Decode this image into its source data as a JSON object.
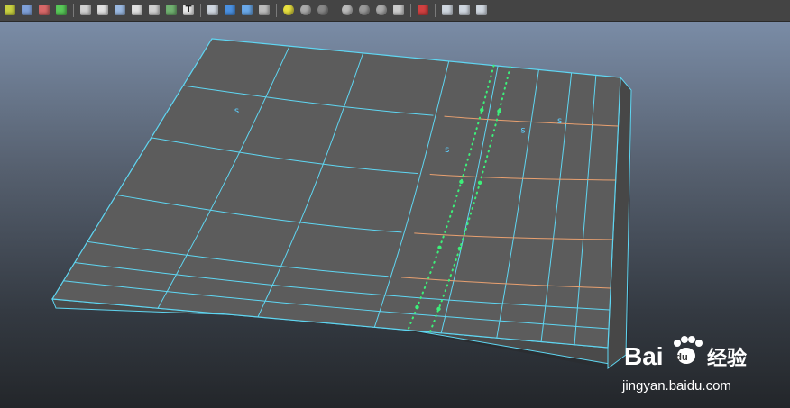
{
  "toolbar": {
    "buttons": [
      {
        "name": "panel-layout-button",
        "icon": "columns-icon"
      },
      {
        "name": "select-camera-button",
        "icon": "camera-icon"
      },
      {
        "name": "bookmark-button",
        "icon": "bookmark-icon"
      },
      {
        "name": "image-plane-button",
        "icon": "image-plane-icon"
      },
      {
        "name": "grid-toggle-button",
        "icon": "grid-icon"
      },
      {
        "name": "film-gate-button",
        "icon": "film-gate-icon"
      },
      {
        "name": "resolution-gate-button",
        "icon": "resolution-gate-icon"
      },
      {
        "name": "gate-mask-button",
        "icon": "gate-mask-icon"
      },
      {
        "name": "field-chart-button",
        "icon": "field-chart-icon"
      },
      {
        "name": "safe-action-button",
        "icon": "safe-action-icon"
      },
      {
        "name": "safe-title-button",
        "icon": "safe-title-icon"
      },
      {
        "name": "wireframe-button",
        "icon": "wireframe-cube-icon"
      },
      {
        "name": "smooth-shade-button",
        "icon": "shaded-cube-icon"
      },
      {
        "name": "wireframe-on-shaded-button",
        "icon": "wire-shaded-cube-icon"
      },
      {
        "name": "textured-button",
        "icon": "checker-icon"
      },
      {
        "name": "use-all-lights-button",
        "icon": "light-bulb-icon"
      },
      {
        "name": "shadows-button",
        "icon": "shadow-sphere-icon"
      },
      {
        "name": "screen-space-ao-button",
        "icon": "ao-sphere-icon"
      },
      {
        "name": "motion-blur-button",
        "icon": "motion-blur-icon"
      },
      {
        "name": "multisample-aa-button",
        "icon": "aa-icon"
      },
      {
        "name": "depth-of-field-button",
        "icon": "dof-icon"
      },
      {
        "name": "xray-button",
        "icon": "xray-icon"
      },
      {
        "name": "isolate-select-button",
        "icon": "isolate-icon"
      },
      {
        "name": "xray-joints-button",
        "icon": "xray-joints-icon"
      },
      {
        "name": "xray-components-button",
        "icon": "xray-components-icon"
      },
      {
        "name": "two-sided-lighting-button",
        "icon": "two-sided-icon"
      }
    ],
    "label_glyph": "T"
  },
  "viewport": {
    "subdiv_marker": "s"
  },
  "colors": {
    "mesh_face": "#5c5c5c",
    "wire": "#5fd6f2",
    "edge_loop": "#e8a070",
    "selected_edge": "#3cf07a"
  },
  "watermark": {
    "brand": "Bai",
    "brand_cn": "经验",
    "url": "jingyan.baidu.com"
  }
}
